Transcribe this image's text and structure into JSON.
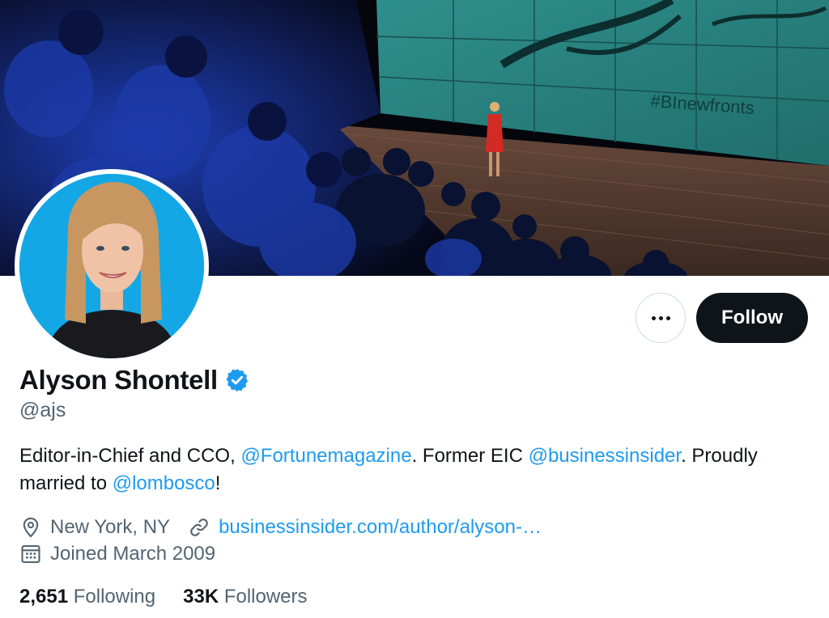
{
  "banner": {
    "screen_text": "#BInewfronts"
  },
  "actions": {
    "follow_label": "Follow"
  },
  "profile": {
    "display_name": "Alyson Shontell",
    "handle": "@ajs",
    "bio": {
      "part1": "Editor-in-Chief and CCO, ",
      "mention1": "@Fortunemagazine",
      "part2": ". Former EIC ",
      "mention2": "@businessinsider",
      "part3": ". Proudly married to ",
      "mention3": "@lombosco",
      "part4": "!"
    },
    "location": "New York, NY",
    "website": "businessinsider.com/author/alyson-…",
    "joined": "Joined March 2009"
  },
  "stats": {
    "following_count": "2,651",
    "following_label": "Following",
    "followers_count": "33K",
    "followers_label": "Followers"
  },
  "colors": {
    "accent": "#1d9bf0",
    "text": "#0f1419",
    "muted": "#536471",
    "follow_bg": "#0f1419"
  }
}
